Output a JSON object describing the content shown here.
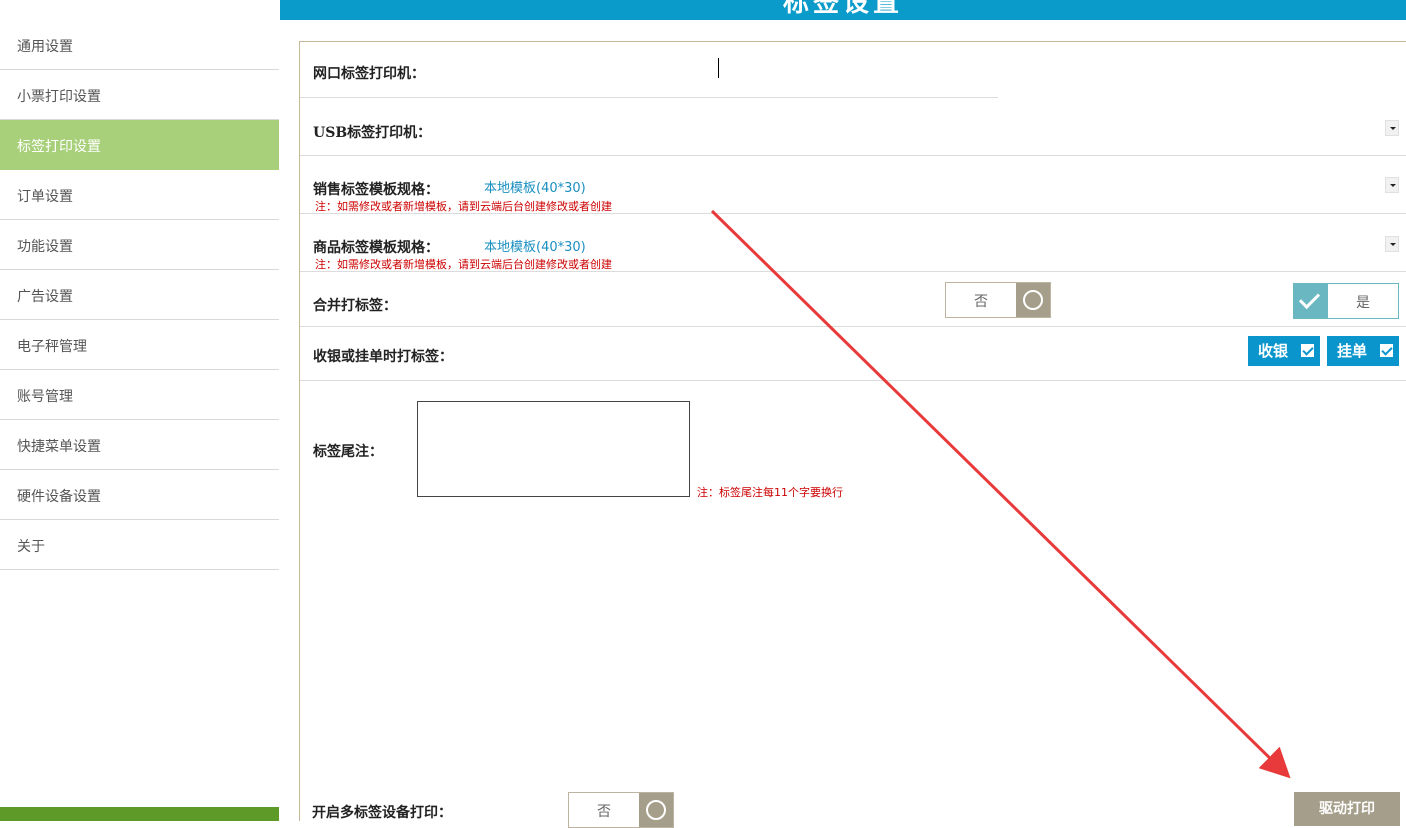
{
  "header": {
    "title": "标签设置"
  },
  "sidebar": {
    "items": [
      {
        "label": "通用设置",
        "active": false
      },
      {
        "label": "小票打印设置",
        "active": false
      },
      {
        "label": "标签打印设置",
        "active": true
      },
      {
        "label": "订单设置",
        "active": false
      },
      {
        "label": "功能设置",
        "active": false
      },
      {
        "label": "广告设置",
        "active": false
      },
      {
        "label": "电子秤管理",
        "active": false
      },
      {
        "label": "账号管理",
        "active": false
      },
      {
        "label": "快捷菜单设置",
        "active": false
      },
      {
        "label": "硬件设备设置",
        "active": false
      },
      {
        "label": "关于",
        "active": false
      }
    ]
  },
  "form": {
    "network_printer_label": "网口标签打印机：",
    "usb_printer_label": "USB标签打印机：",
    "sales_template_label": "销售标签模板规格：",
    "sales_template_value": "本地模板(40*30)",
    "sales_template_note": "注：如需修改或者新增模板，请到云端后台创建修改或者创建",
    "goods_template_label": "商品标签模板规格：",
    "goods_template_value": "本地模板(40*30)",
    "goods_template_note": "注：如需修改或者新增模板，请到云端后台创建修改或者创建",
    "merge_label": "合并打标签：",
    "merge_no": "否",
    "merge_yes": "是",
    "checkout_label": "收银或挂单时打标签：",
    "checkout_option": "收银",
    "hold_option": "挂单",
    "footer_label": "标签尾注：",
    "footer_note": "注：标签尾注每11个字要换行",
    "multi_device_label": "开启多标签设备打印：",
    "multi_device_no": "否",
    "driver_print_button": "驱动打印"
  },
  "colors": {
    "header_blue": "#0a9bcb",
    "active_green": "#a8d07a",
    "toggle_gray": "#a59e8a",
    "toggle_teal": "#6bb7c1",
    "check_blue": "#0a95cc",
    "note_red": "#cc0000",
    "arrow_red": "#e83a3a"
  }
}
